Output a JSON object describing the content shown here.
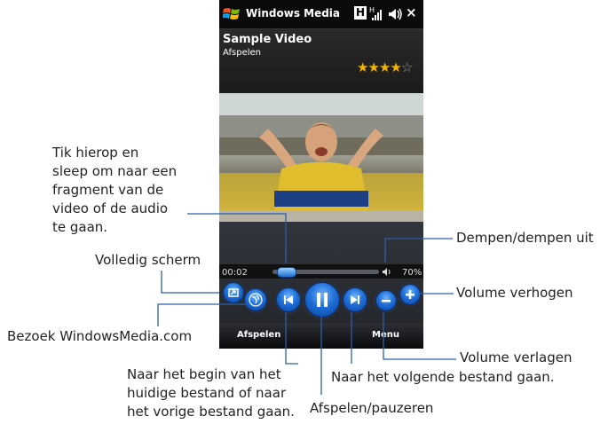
{
  "device": {
    "app_title": "Windows Media",
    "status_indicator": "H",
    "close_glyph": "×"
  },
  "player": {
    "video_title": "Sample Video",
    "status": "Afspelen",
    "rating": {
      "value": 4,
      "max": 5
    },
    "elapsed": "00:02",
    "volume_percent": "70%",
    "seek_position_fraction": 0.05
  },
  "softkeys": {
    "left": "Afspelen",
    "right": "Menu"
  },
  "callouts": {
    "seek": [
      "Tik hierop en",
      "sleep om naar een",
      "fragment van de",
      "video of de audio",
      "te gaan."
    ],
    "fullscreen": "Volledig scherm",
    "visit": "Bezoek WindowsMedia.com",
    "prev": [
      "Naar het begin van het",
      "huidige bestand of naar",
      "het vorige bestand gaan."
    ],
    "play": "Afspelen/pauzeren",
    "next": "Naar het volgende bestand gaan.",
    "voldown": "Volume verlagen",
    "volup": "Volume verhogen",
    "mute": "Dempen/dempen uit"
  },
  "colors": {
    "accent_blue": "#1f6fd8",
    "star": "#f2b400",
    "callout_line": "#2a5fa8"
  }
}
